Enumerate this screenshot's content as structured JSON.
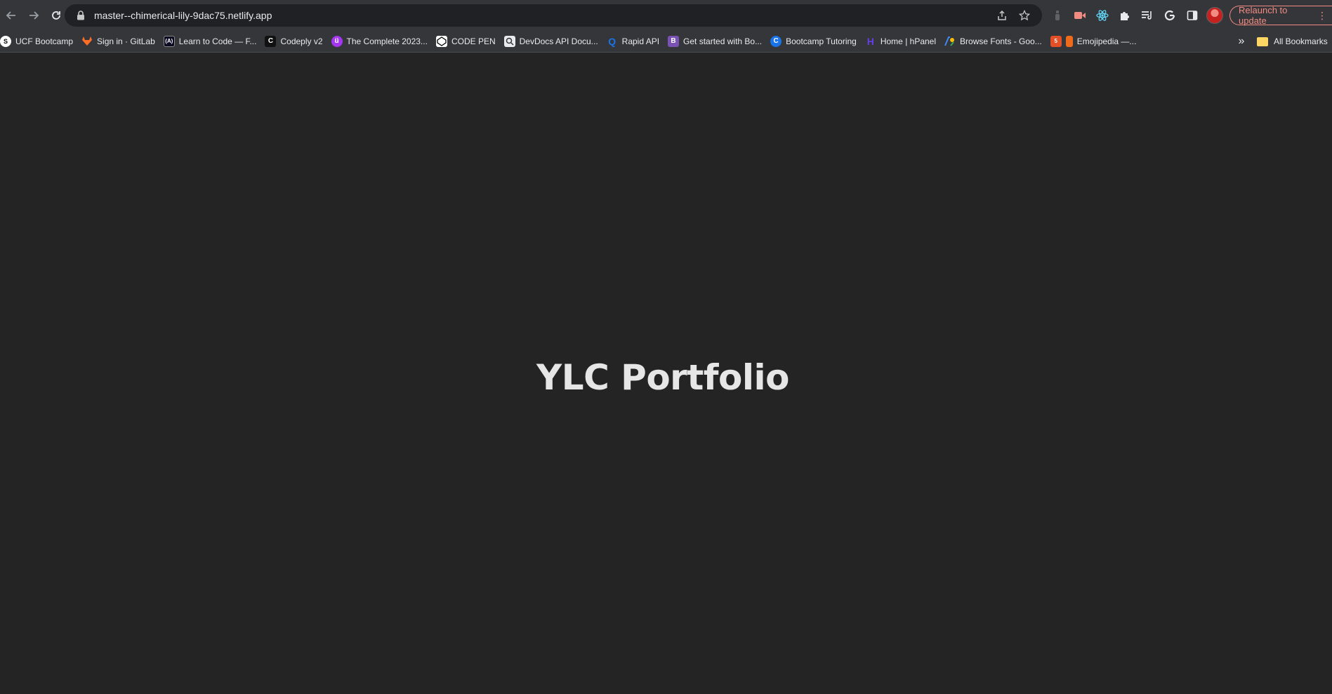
{
  "browser": {
    "url": "master--chimerical-lily-9dac75.netlify.app",
    "relaunch_label": "Relaunch to update",
    "nav": {
      "back_icon": "arrow-left-icon",
      "forward_icon": "arrow-right-icon",
      "reload_icon": "reload-icon"
    }
  },
  "bookmarks": {
    "items": [
      {
        "label": "UCF Bootcamp",
        "icon": "ucf-icon",
        "color": "#ffffff"
      },
      {
        "label": "Sign in · GitLab",
        "icon": "gitlab-icon",
        "color": "#fc6d26"
      },
      {
        "label": "Learn to Code — F...",
        "icon": "freecodecamp-icon",
        "color": "#0a0a23"
      },
      {
        "label": "Codeply v2",
        "icon": "codeply-icon",
        "color": "#111111"
      },
      {
        "label": "The Complete 2023...",
        "icon": "udemy-icon",
        "color": "#a435f0"
      },
      {
        "label": "CODE PEN",
        "icon": "codepen-icon",
        "color": "#ffffff"
      },
      {
        "label": "DevDocs API Docu...",
        "icon": "devdocs-icon",
        "color": "#e8eaed"
      },
      {
        "label": "Rapid API",
        "icon": "rapidapi-icon",
        "color": "#1a73e8"
      },
      {
        "label": "Get started with Bo...",
        "icon": "bootstrap-icon",
        "color": "#7952b3"
      },
      {
        "label": "Bootcamp Tutoring",
        "icon": "tutoring-icon",
        "color": "#1a73e8"
      },
      {
        "label": "Home | hPanel",
        "icon": "hostinger-icon",
        "color": "#673de6"
      },
      {
        "label": "Browse Fonts - Goo...",
        "icon": "google-fonts-icon",
        "color": "#4285f4"
      },
      {
        "label": "",
        "icon": "html5-icon",
        "color": "#e34f26"
      },
      {
        "label": "Emojipedia —...",
        "icon": "emojipedia-icon",
        "color": "#f06a1c"
      }
    ],
    "more_icon": "chevron-double-right-icon",
    "all_label": "All Bookmarks"
  },
  "page": {
    "title": "YLC Portfolio"
  }
}
